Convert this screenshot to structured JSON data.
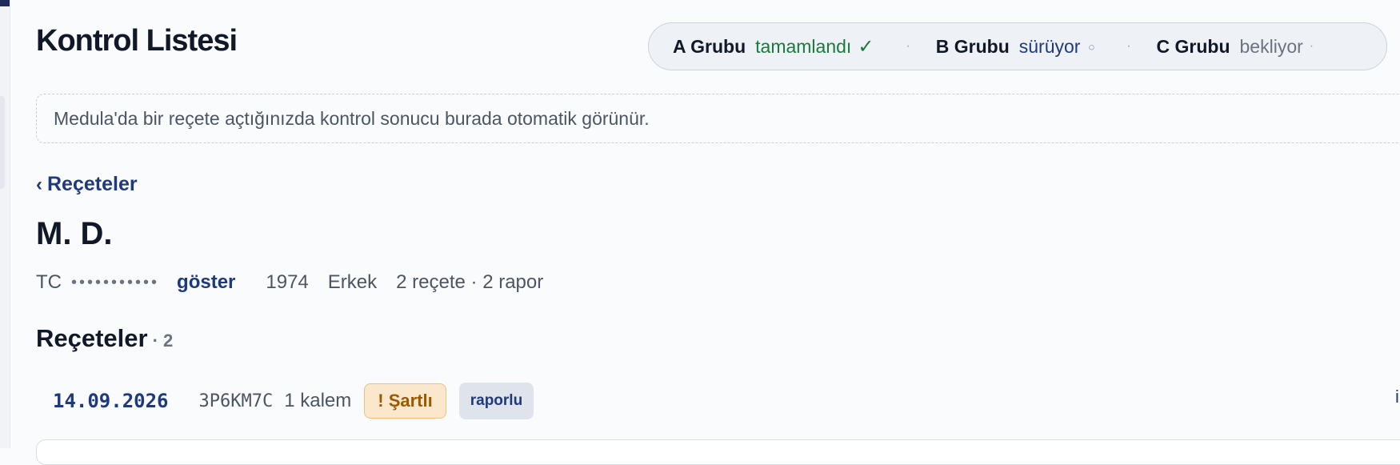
{
  "page": {
    "title": "Kontrol Listesi"
  },
  "status": {
    "groups": [
      {
        "name": "A Grubu",
        "state": "tamamlandı",
        "icon": "check-icon"
      },
      {
        "name": "B Grubu",
        "state": "sürüyor",
        "icon": "spinner-icon"
      },
      {
        "name": "C Grubu",
        "state": "bekliyor",
        "icon": "dot-icon"
      }
    ],
    "colors": {
      "done": "#1a7a3c",
      "running": "#1f3a7a",
      "waiting": "#6b7280"
    }
  },
  "banner": {
    "text": "Medula'da bir reçete açtığınızda kontrol sonucu burada otomatik görünür."
  },
  "nav": {
    "back_label": "Reçeteler"
  },
  "patient": {
    "name": "M. D.",
    "tc_label": "TC",
    "tc_masked": "•••••••••••",
    "show_label": "göster",
    "birth_year": "1974",
    "gender": "Erkek",
    "summary": "2 reçete · 2 rapor"
  },
  "prescriptions": {
    "title": "Reçeteler",
    "count": "· 2",
    "items": [
      {
        "date": "14.09.2026",
        "code": "3P6KM7C",
        "items": "1 kalem",
        "condition_badge": "! Şartlı",
        "report_badge": "raporlu"
      }
    ]
  },
  "colors": {
    "accent": "#1f3a7a",
    "warning_bg": "#fbe8cc",
    "warning_text": "#9a5a00"
  }
}
